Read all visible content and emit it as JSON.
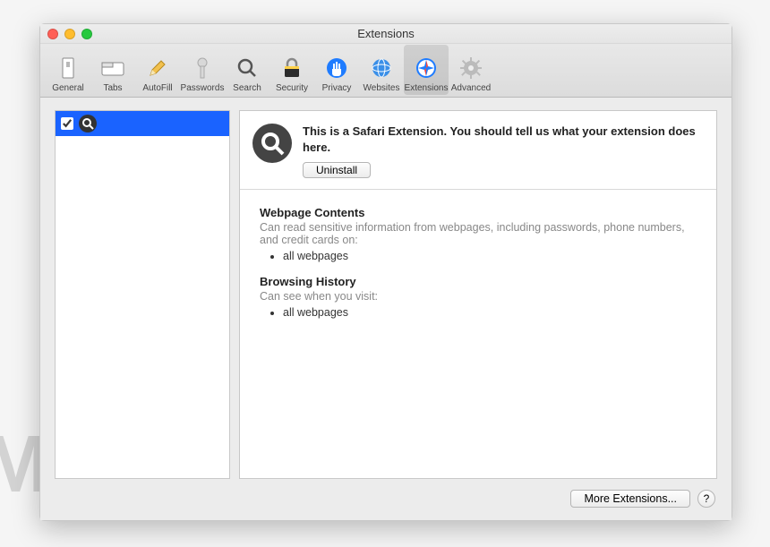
{
  "window": {
    "title": "Extensions"
  },
  "tabs": [
    {
      "name": "general",
      "label": "General"
    },
    {
      "name": "tabs",
      "label": "Tabs"
    },
    {
      "name": "autofill",
      "label": "AutoFill"
    },
    {
      "name": "passwords",
      "label": "Passwords"
    },
    {
      "name": "search",
      "label": "Search"
    },
    {
      "name": "security",
      "label": "Security"
    },
    {
      "name": "privacy",
      "label": "Privacy"
    },
    {
      "name": "websites",
      "label": "Websites"
    },
    {
      "name": "extensions",
      "label": "Extensions",
      "selected": true
    },
    {
      "name": "advanced",
      "label": "Advanced"
    }
  ],
  "sidebar": {
    "items": [
      {
        "enabled": true,
        "icon": "search"
      }
    ]
  },
  "detail": {
    "description": "This is a Safari Extension. You should tell us what your extension does here.",
    "uninstall_label": "Uninstall",
    "sections": [
      {
        "title": "Webpage Contents",
        "desc": "Can read sensitive information from webpages, including passwords, phone numbers, and credit cards on:",
        "items": [
          "all webpages"
        ]
      },
      {
        "title": "Browsing History",
        "desc": "Can see when you visit:",
        "items": [
          "all webpages"
        ]
      }
    ]
  },
  "footer": {
    "more_label": "More Extensions...",
    "help_label": "?"
  },
  "watermark": "MALWARETIPS"
}
